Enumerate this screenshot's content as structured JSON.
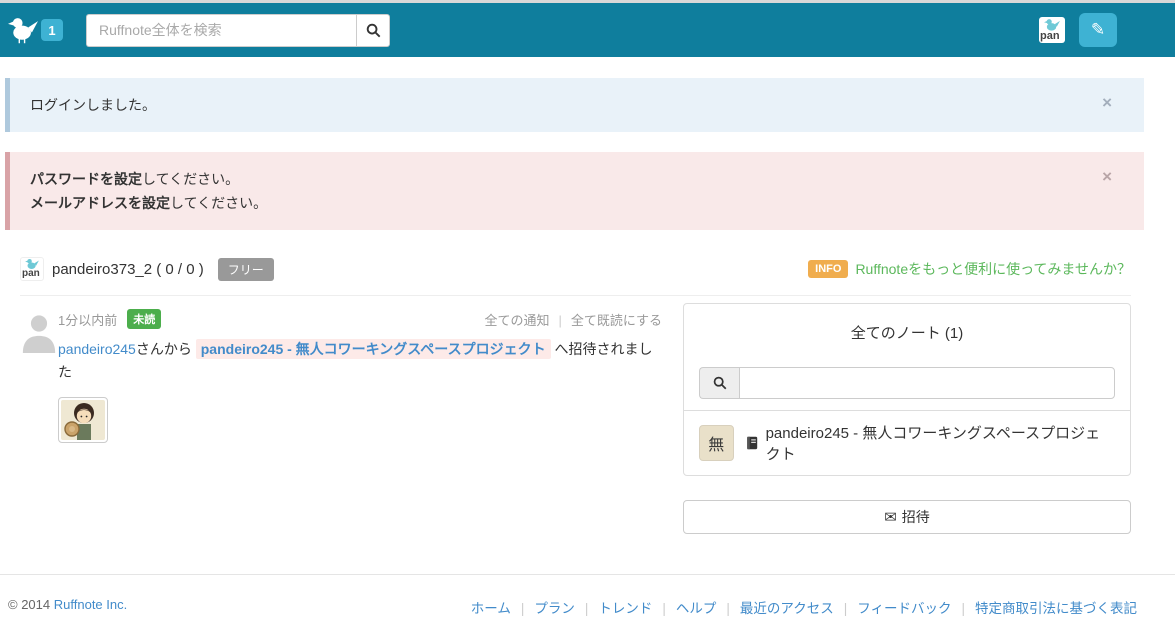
{
  "colors": {
    "header_teal": "#0f7e9d",
    "accent_light_blue": "#3eb2d3",
    "info_alert_bg": "#e9f2f9",
    "warning_alert_bg": "#f9e9e9",
    "info_badge_orange": "#f0ad4e",
    "promo_green": "#5cb85c",
    "unread_green": "#4cae4c",
    "link_blue": "#428bca",
    "note_link_highlight_bg": "#fdeae8",
    "free_badge_gray": "#999999"
  },
  "icons": {
    "pencil": "✎",
    "envelope": "✉",
    "close": "×"
  },
  "header": {
    "notification_count": "1",
    "search_placeholder": "Ruffnote全体を検索",
    "avatar_label": "pan"
  },
  "alerts": {
    "login": {
      "text": "ログインしました。"
    },
    "settings": {
      "lines": [
        {
          "bold": "パスワードを設定",
          "rest": "してください。"
        },
        {
          "bold": "メールアドレスを設定",
          "rest": "してください。"
        }
      ]
    }
  },
  "user_bar": {
    "avatar_label": "pan",
    "username": "pandeiro373_2 ( 0 / 0 )",
    "plan_badge": "フリー",
    "info_badge": "INFO",
    "promo_link": "Ruffnoteをもっと便利に使ってみませんか？"
  },
  "notifications": {
    "time": "1分以内前",
    "unread_badge": "未読",
    "all_notifications_link": "全ての通知",
    "mark_all_read_link": "全て既読にする",
    "separator": "|",
    "message": {
      "sender": "pandeiro245",
      "middle": "さんから ",
      "note_link": "pandeiro245 - 無人コワーキングスペースプロジェクト",
      "suffix": " へ招待されました"
    }
  },
  "notes_panel": {
    "title": "全てのノート (1)",
    "search_value": "",
    "note": {
      "icon_char": "無",
      "title": "pandeiro245 - 無人コワーキングスペースプロジェクト"
    },
    "invite_button": "招待"
  },
  "footer": {
    "copyright": "© 2014",
    "company_link": "Ruffnote Inc.",
    "separator": "|",
    "links": [
      "ホーム",
      "プラン",
      "トレンド",
      "ヘルプ",
      "最近のアクセス",
      "フィードバック",
      "特定商取引法に基づく表記"
    ]
  }
}
